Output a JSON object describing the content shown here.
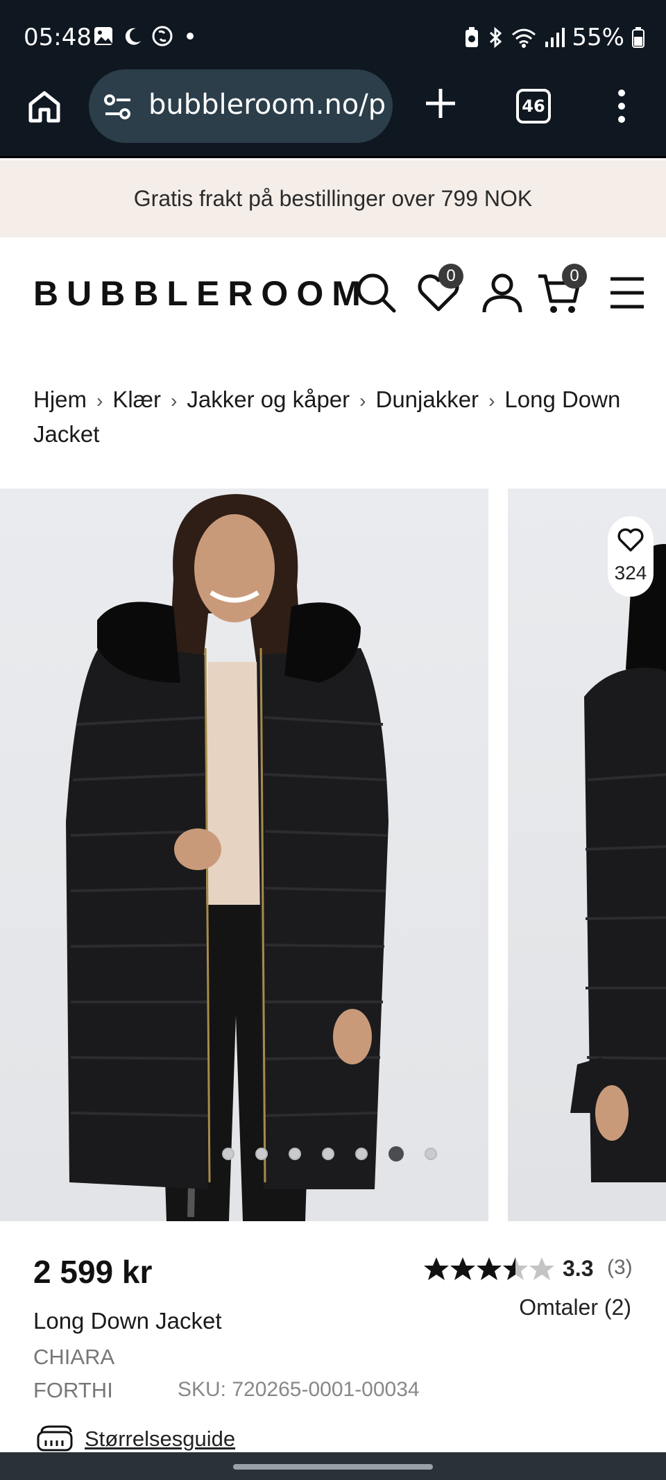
{
  "status_bar": {
    "time": "05:48",
    "battery": "55%",
    "icons": [
      "gallery-icon",
      "moon-icon",
      "shazam-icon",
      "dot-icon",
      "battery-saver-icon",
      "bluetooth-icon",
      "wifi-icon",
      "signal-icon",
      "battery-icon"
    ]
  },
  "browser": {
    "url": "bubbleroom.no/p",
    "tab_count": "46"
  },
  "promo": {
    "text": "Gratis frakt på bestillinger over 799 NOK"
  },
  "header": {
    "logo": "BUBBLEROOM",
    "wishlist_count": "0",
    "cart_count": "0"
  },
  "breadcrumb": {
    "items": [
      "Hjem",
      "Klær",
      "Jakker og kåper",
      "Dunjakker",
      "Long Down Jacket"
    ]
  },
  "gallery": {
    "wishlist_count": "324",
    "dot_count": 7,
    "active_dot": 5
  },
  "product": {
    "price": "2 599 kr",
    "name": "Long Down Jacket",
    "brand_line1": "CHIARA",
    "brand_line2": "FORTHI",
    "sku": "SKU: 720265-0001-00034",
    "rating": "3.3",
    "rating_stars": 3.3,
    "rating_count": "(3)",
    "reviews_link": "Omtaler (2)",
    "size_guide": "Størrelsesguide"
  }
}
